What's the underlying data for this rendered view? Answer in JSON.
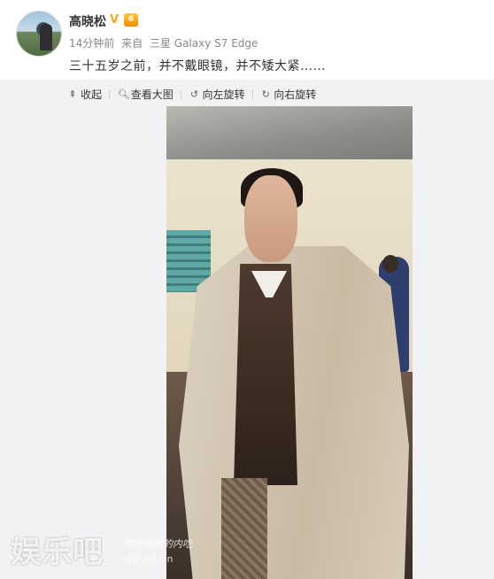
{
  "post": {
    "username": "高晓松",
    "verified_badge": "V",
    "level_badge": "6",
    "time": "14分钟前",
    "source_prefix": "来自",
    "source": "三星 Galaxy S7 Edge",
    "content": "三十五岁之前，并不戴眼镜，并不矮大紧……"
  },
  "toolbar": {
    "items": [
      {
        "icon": "collapse-icon",
        "label": "收起"
      },
      {
        "icon": "zoom-icon",
        "label": "查看大图"
      },
      {
        "icon": "rotate-left-icon",
        "label": "向左旋转"
      },
      {
        "icon": "rotate-right-icon",
        "label": "向右旋转"
      }
    ]
  },
  "watermark": {
    "logo": "娱乐吧",
    "tagline": "你懂得你的内吃",
    "url": "ww.sz.cn"
  },
  "colors": {
    "panel_bg": "#f2f2f5",
    "badge_orange": "#f5a623",
    "text_dark": "#333333",
    "text_meta": "#888888"
  }
}
